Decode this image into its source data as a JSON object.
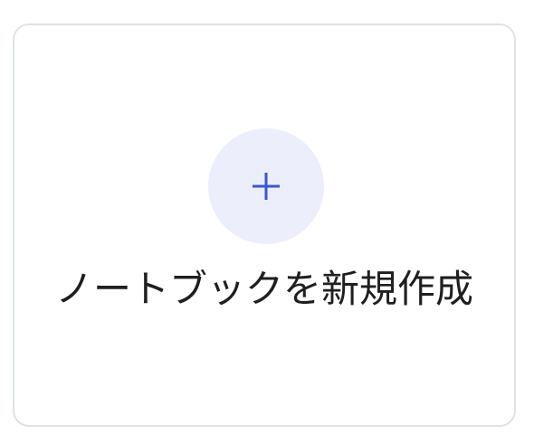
{
  "card": {
    "label": "ノートブックを新規作成",
    "icon": "plus-icon",
    "icon_color": "#3b57d6",
    "icon_bg_color": "#eceefb",
    "border_color": "#dde3e7"
  }
}
